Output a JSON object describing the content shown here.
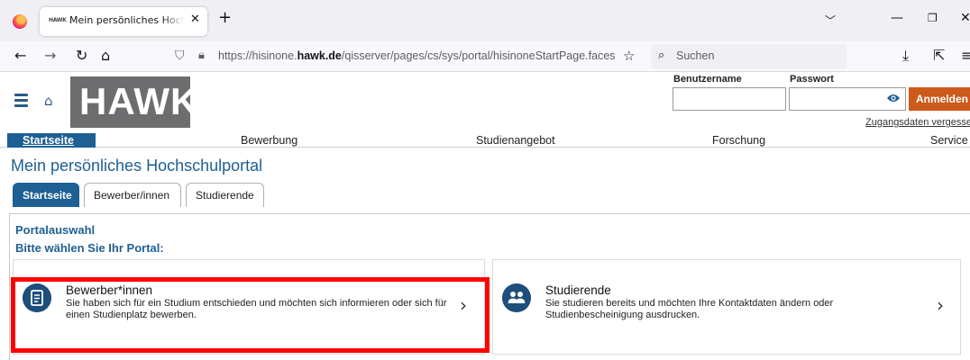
{
  "browser": {
    "tab_title": "Mein persönliches Hochschulportal",
    "tab_favicon": "HAWK",
    "url_prefix": "https://hisinone.",
    "url_domain": "hawk.de",
    "url_path": "/qisserver/pages/cs/sys/portal/hisinoneStartPage.faces",
    "search_placeholder": "Suchen",
    "icons": [
      "firefox-icon",
      "close-icon",
      "plus-icon",
      "chevron-down-icon",
      "minimize-icon",
      "maximize-icon",
      "back-icon",
      "forward-icon",
      "reload-icon",
      "home-icon",
      "shield-icon",
      "lock-icon",
      "star-icon",
      "search-icon",
      "download-icon",
      "extensions-icon",
      "hamburger-icon"
    ]
  },
  "header": {
    "logo_text": "HAWK",
    "login": {
      "username_label": "Benutzername",
      "password_label": "Passwort",
      "submit_label": "Anmelden",
      "forgot_label": "Zugangsdaten vergessen?"
    }
  },
  "main_nav": [
    "Startseite",
    "Bewerbung",
    "Studienangebot",
    "Forschung",
    "Service"
  ],
  "page_title": "Mein persönliches Hochschulportal",
  "sub_tabs": [
    "Startseite",
    "Bewerber/innen",
    "Studierende"
  ],
  "portal": {
    "heading": "Portalauswahl",
    "subheading": "Bitte wählen Sie Ihr Portal:",
    "cards": [
      {
        "title": "Bewerber*innen",
        "description": "Sie haben sich für ein Studium entschieden und möchten sich informieren oder sich für einen Studienplatz bewerben.",
        "icon": "document-icon"
      },
      {
        "title": "Studierende",
        "description": "Sie studieren bereits und möchten Ihre Kontaktdaten ändern oder Studienbescheinigung ausdrucken.",
        "icon": "users-icon"
      }
    ]
  },
  "colors": {
    "accent": "#1e5f94",
    "login_button": "#cc5a1b",
    "highlight": "#ff0000",
    "logo_bg": "#6d6d6f"
  }
}
